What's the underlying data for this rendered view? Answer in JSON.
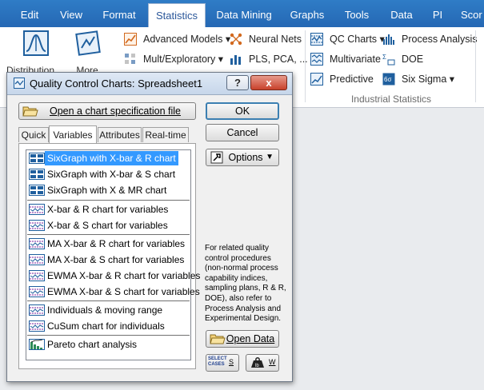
{
  "ribbon_tabs": [
    "Edit",
    "View",
    "Format",
    "Statistics",
    "Data Mining",
    "Graphs",
    "Tools",
    "Data",
    "PI",
    "Scor"
  ],
  "active_tab": "Statistics",
  "ribbon": {
    "partial_buttons": {
      "distribution": "Distribution",
      "more": "More"
    },
    "mid_group": {
      "advanced_models": "Advanced Models",
      "mult_exploratory": "Mult/Exploratory",
      "neural_nets": "Neural Nets",
      "pls_pca": "PLS, PCA, ..."
    },
    "industrial_group": {
      "label": "Industrial Statistics",
      "qc_charts": "QC Charts",
      "process_analysis": "Process Analysis",
      "multivariate": "Multivariate",
      "doe": "DOE",
      "predictive": "Predictive",
      "six_sigma": "Six Sigma"
    }
  },
  "dialog": {
    "title": "Quality Control Charts: Spreadsheet1",
    "help_button": "?",
    "close_button": "x",
    "open_spec_button": "Open a chart specification file",
    "ok_button": "OK",
    "cancel_button": "Cancel",
    "options_button": "Options",
    "tabs": [
      "Quick",
      "Variables",
      "Attributes",
      "Real-time"
    ],
    "active_tab": "Variables",
    "chart_list": [
      "SixGraph with X-bar & R chart",
      "SixGraph with X-bar & S chart",
      "SixGraph with X & MR chart",
      "X-bar & R chart for variables",
      "X-bar & S chart for variables",
      "MA  X-bar & R chart for variables",
      "MA  X-bar & S chart for variables",
      "EWMA  X-bar & R chart for variables",
      "EWMA  X-bar & S chart for variables",
      "Individuals & moving range",
      "CuSum chart for individuals",
      "Pareto chart analysis"
    ],
    "selected_item": "SixGraph with X-bar & R chart",
    "info_text": "For related quality control procedures (non-normal process capability indices, sampling plans, R & R, DOE), also refer to Process Analysis and Experimental Design.",
    "open_data_button": "Open Data",
    "select_cases_label": "SELECT CASES",
    "select_cases_key": "S",
    "weight_key": "W"
  },
  "colors": {
    "ribbon_blue": "#2a6ebb",
    "selection": "#3399ff",
    "icon_blue": "#1f5f9e"
  }
}
